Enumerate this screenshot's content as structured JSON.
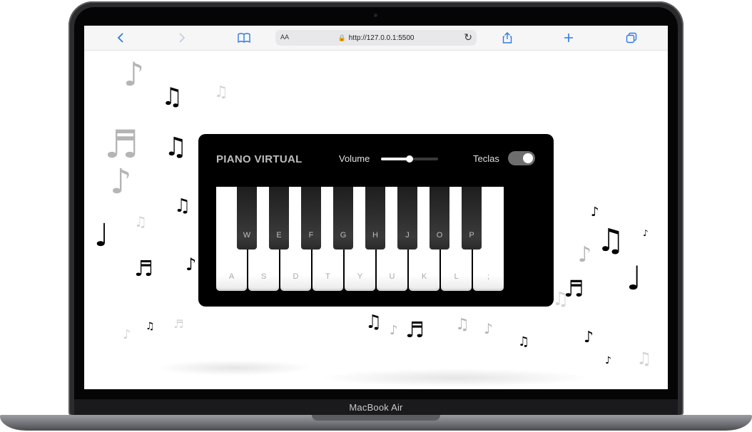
{
  "device": {
    "brand": "MacBook Air"
  },
  "browser": {
    "back_icon": "chevron-left-icon",
    "forward_icon": "chevron-right-icon",
    "reader_icon": "book-icon",
    "text_size_label": "AA",
    "url": "http://127.0.0.1:5500",
    "reload_icon": "reload-icon",
    "share_icon": "share-icon",
    "new_tab_icon": "plus-icon",
    "tabs_icon": "tabs-icon"
  },
  "piano": {
    "title": "PIANO VIRTUAL",
    "volume_label": "Volume",
    "volume_value": 0.5,
    "keys_label": "Teclas",
    "keys_toggle_on": true,
    "white_keys": [
      "A",
      "S",
      "D",
      "T",
      "Y",
      "U",
      "K",
      "L",
      ";"
    ],
    "black_keys": [
      "W",
      "E",
      "F",
      "G",
      "H",
      "J",
      "O",
      "P"
    ]
  },
  "colors": {
    "accent": "#2f7ae5",
    "card": "#000000",
    "toggle": "#6e6e6e"
  }
}
